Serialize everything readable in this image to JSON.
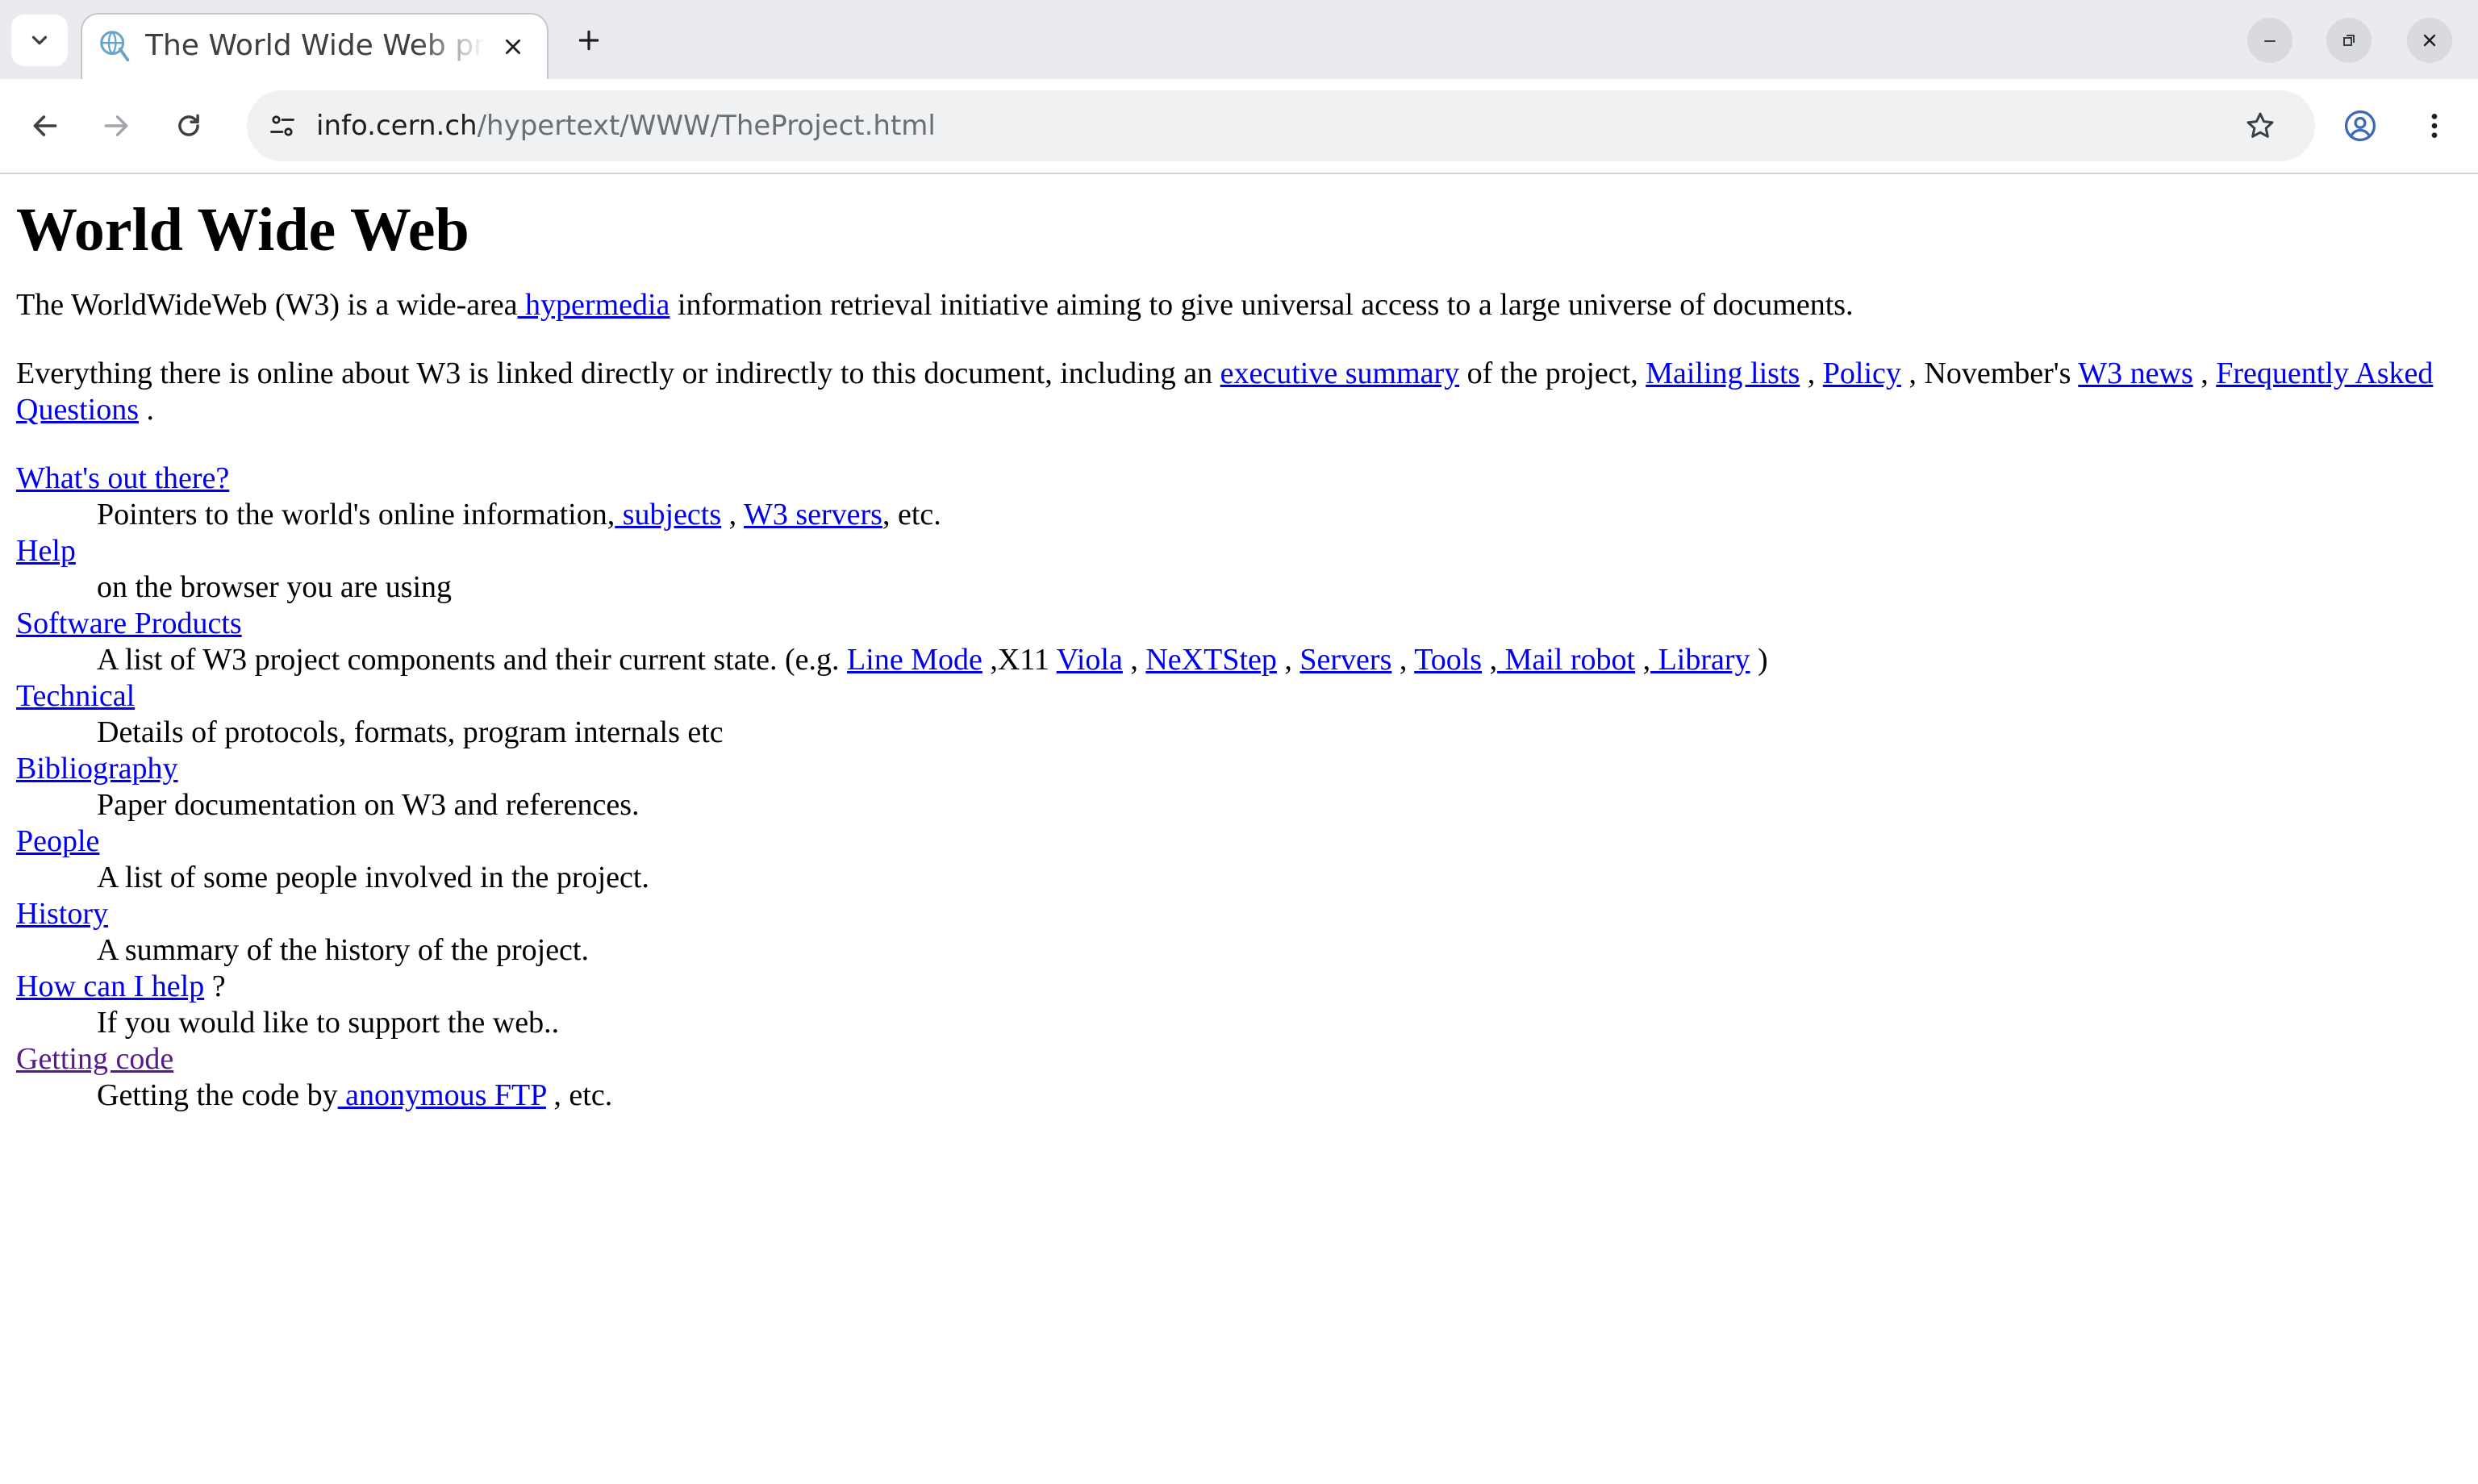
{
  "browser": {
    "tab_title": "The World Wide Web project",
    "url_host": "info.cern.ch",
    "url_path": "/hypertext/WWW/TheProject.html",
    "icons": [
      "tab-search-icon",
      "globe-favicon-icon",
      "close-icon",
      "plus-icon",
      "minimize-icon",
      "restore-icon",
      "close-window-icon",
      "back-arrow-icon",
      "forward-arrow-icon",
      "reload-icon",
      "site-info-icon",
      "star-icon",
      "profile-icon",
      "kebab-menu-icon"
    ],
    "colors": {
      "chrome_bg": "#e9ebee",
      "link": "#0000ee",
      "visited_link": "#551a8b"
    }
  },
  "page": {
    "title": "World Wide Web",
    "intro": {
      "t1": "The WorldWideWeb (W3) is a wide-area",
      "link_hypermedia": " hypermedia",
      "t2": " information retrieval initiative aiming to give universal access to a large universe of documents."
    },
    "para2": {
      "t1": "Everything there is online about W3 is linked directly or indirectly to this document, including an ",
      "link_exec": "executive summary",
      "t2": " of the project, ",
      "link_mailing": "Mailing lists",
      "t3": " , ",
      "link_policy": "Policy",
      "t4": " , November's ",
      "link_news": "W3 news",
      "t5": " , ",
      "link_faq": "Frequently Asked Questions",
      "t6": " ."
    },
    "items": {
      "whats_out": {
        "term": "What's out there?",
        "d1": "Pointers to the world's online information,",
        "l_subjects": " subjects",
        "d2": " , ",
        "l_servers": "W3 servers",
        "d3": ", etc."
      },
      "help": {
        "term": "Help",
        "desc": "on the browser you are using"
      },
      "software": {
        "term": "Software Products",
        "d1": "A list of W3 project components and their current state. (e.g. ",
        "l_linemode": "Line Mode",
        "d2": " ,X11 ",
        "l_viola": "Viola",
        "d3": " , ",
        "l_nextstep": "NeXTStep",
        "d4": " , ",
        "l_servers": "Servers",
        "d5": " , ",
        "l_tools": "Tools",
        "d6": " ,",
        "l_mailrobot": " Mail robot",
        "d7": " ,",
        "l_library": " Library",
        "d8": " )"
      },
      "technical": {
        "term": "Technical",
        "desc": "Details of protocols, formats, program internals etc"
      },
      "bibliography": {
        "term": "Bibliography",
        "desc": "Paper documentation on W3 and references."
      },
      "people": {
        "term": "People",
        "desc": "A list of some people involved in the project."
      },
      "history": {
        "term": "History",
        "desc": "A summary of the history of the project."
      },
      "howhelp": {
        "term": "How can I help",
        "suffix": " ?",
        "desc": "If you would like to support the web.."
      },
      "getting": {
        "term": "Getting code",
        "d1": "Getting the code by",
        "l_ftp": " anonymous FTP",
        "d2": " , etc."
      }
    }
  }
}
